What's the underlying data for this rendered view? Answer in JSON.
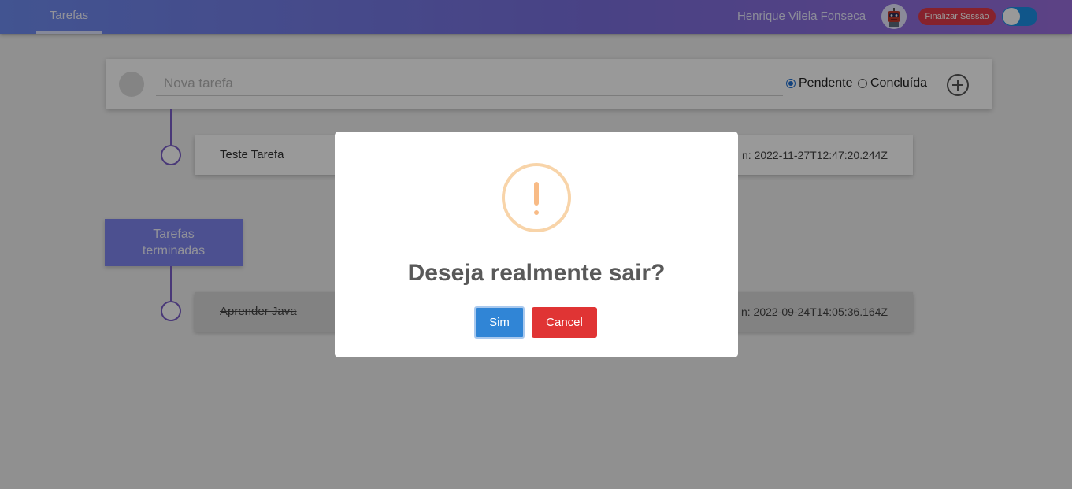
{
  "header": {
    "tab_label": "Tarefas",
    "user_name": "Henrique Vilela Fonseca",
    "logout_label": "Finalizar Sessão",
    "toggle_on": true
  },
  "new_task": {
    "placeholder": "Nova tarefa",
    "value": "",
    "status_options": [
      {
        "label": "Pendente",
        "checked": true
      },
      {
        "label": "Concluída",
        "checked": false
      }
    ],
    "add_icon": "plus-circle-icon"
  },
  "pending_tasks": [
    {
      "title": "Teste Tarefa",
      "date_text": "n: 2022-11-27T12:47:20.244Z"
    }
  ],
  "finished_section": {
    "label": "Tarefas terminadas"
  },
  "finished_tasks": [
    {
      "title": "Aprender Java",
      "date_text": "n: 2022-09-24T14:05:36.164Z"
    }
  ],
  "modal": {
    "icon": "warning-icon",
    "title": "Deseja realmente sair?",
    "confirm_label": "Sim",
    "cancel_label": "Cancel"
  },
  "colors": {
    "header_gradient_start": "#6f8cf2",
    "header_gradient_end": "#9a6fde",
    "timeline": "#7a5ec8",
    "confirm_button": "#3085d6",
    "cancel_button": "#e03434",
    "logout_button": "#e03a4a",
    "warning_icon": "#f8bb86"
  }
}
